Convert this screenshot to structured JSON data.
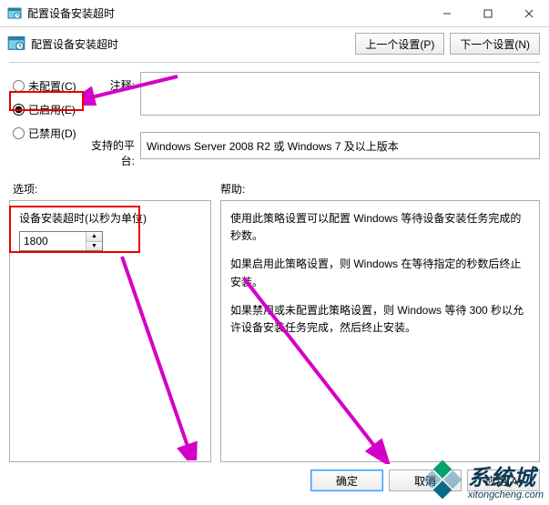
{
  "window": {
    "title": "配置设备安装超时"
  },
  "header": {
    "label": "配置设备安装超时",
    "prev_btn": "上一个设置(P)",
    "next_btn": "下一个设置(N)"
  },
  "radios": {
    "not_configured": "未配置(C)",
    "enabled": "已启用(E)",
    "disabled": "已禁用(D)",
    "selected": "enabled"
  },
  "fields": {
    "comment_label": "注释:",
    "comment_value": "",
    "platform_label": "支持的平台:",
    "platform_value": "Windows Server 2008 R2 或 Windows 7 及以上版本"
  },
  "options": {
    "header_left": "选项:",
    "header_right": "帮助:",
    "timeout_label": "设备安装超时(以秒为单位)",
    "timeout_value": "1800"
  },
  "help": {
    "p1": "使用此策略设置可以配置 Windows 等待设备安装任务完成的秒数。",
    "p2": "如果启用此策略设置，则 Windows 在等待指定的秒数后终止安装。",
    "p3": "如果禁用或未配置此策略设置，则 Windows 等待 300 秒以允许设备安装任务完成，然后终止安装。"
  },
  "footer": {
    "ok": "确定",
    "cancel": "取消",
    "apply": "应用(A)"
  },
  "watermark": {
    "name": "系统城",
    "url": "xitongcheng.com"
  }
}
